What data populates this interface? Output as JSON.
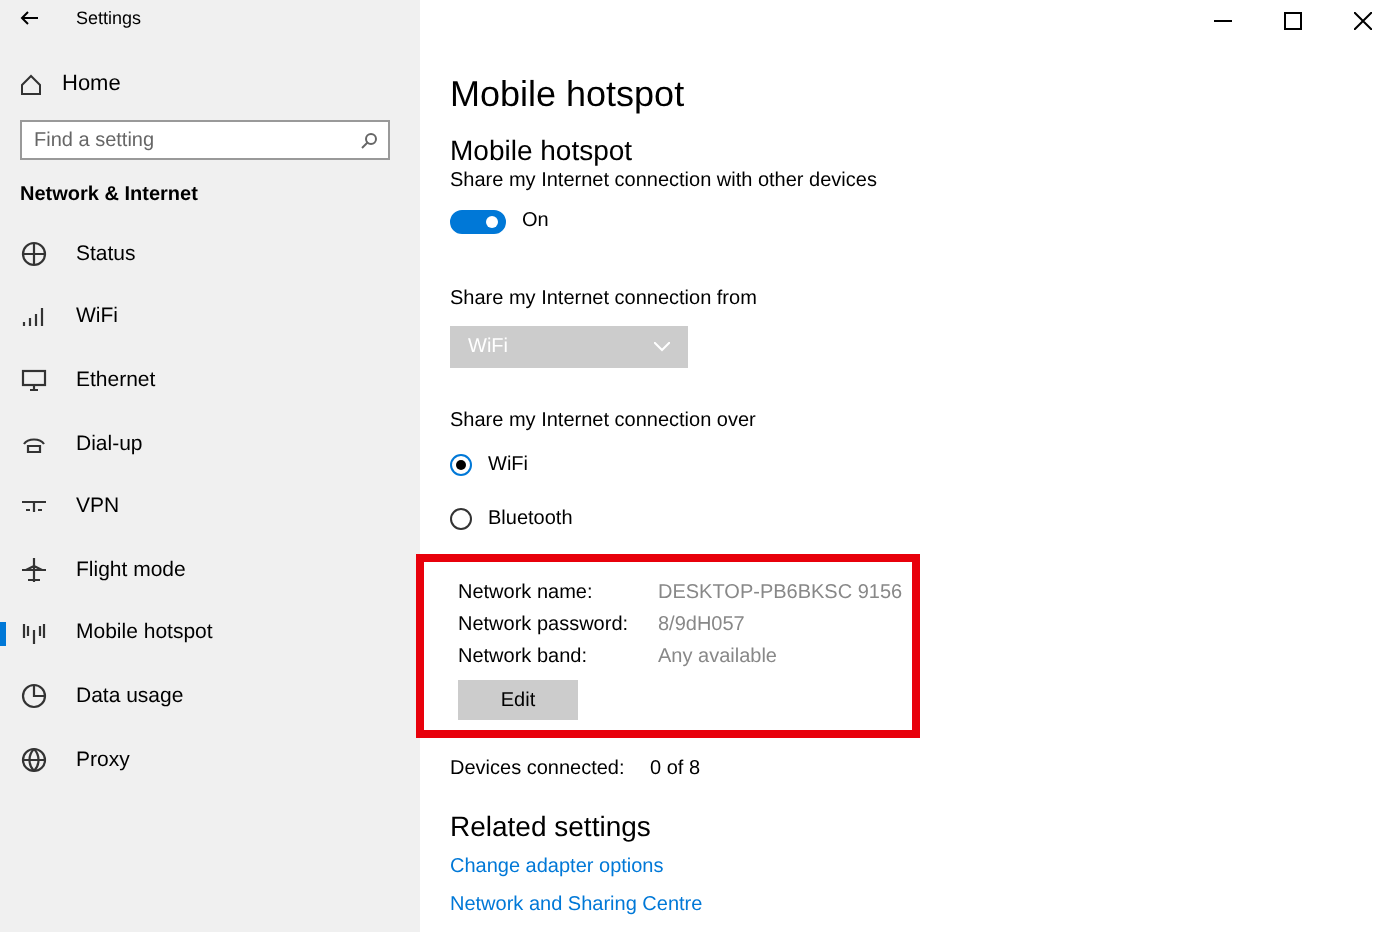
{
  "window": {
    "title": "Settings"
  },
  "sidebar": {
    "home": "Home",
    "search": {
      "placeholder": "Find a setting"
    },
    "section": "Network & Internet",
    "items": [
      {
        "label": "Status",
        "selected": false
      },
      {
        "label": "WiFi",
        "selected": false
      },
      {
        "label": "Ethernet",
        "selected": false
      },
      {
        "label": "Dial-up",
        "selected": false
      },
      {
        "label": "VPN",
        "selected": false
      },
      {
        "label": "Flight mode",
        "selected": false
      },
      {
        "label": "Mobile hotspot",
        "selected": true
      },
      {
        "label": "Data usage",
        "selected": false
      },
      {
        "label": "Proxy",
        "selected": false
      }
    ]
  },
  "page": {
    "title": "Mobile hotspot",
    "section": "Mobile hotspot",
    "share_label": "Share my Internet connection with other devices",
    "toggle": {
      "on": true,
      "label": "On"
    },
    "from_label": "Share my Internet connection from",
    "from_dropdown": {
      "value": "WiFi",
      "disabled": true
    },
    "over_label": "Share my Internet connection over",
    "over_options": [
      {
        "label": "WiFi",
        "selected": true
      },
      {
        "label": "Bluetooth",
        "selected": false
      }
    ],
    "network_info": {
      "highlighted": true,
      "rows": [
        {
          "label": "Network name:",
          "value": "DESKTOP-PB6BKSC 9156"
        },
        {
          "label": "Network password:",
          "value": "8/9dH057"
        },
        {
          "label": "Network band:",
          "value": "Any available"
        }
      ],
      "edit_button": "Edit"
    },
    "devices": {
      "label": "Devices connected:",
      "value": "0 of 8"
    },
    "related": {
      "title": "Related settings",
      "links": [
        "Change adapter options",
        "Network and Sharing Centre"
      ]
    }
  }
}
